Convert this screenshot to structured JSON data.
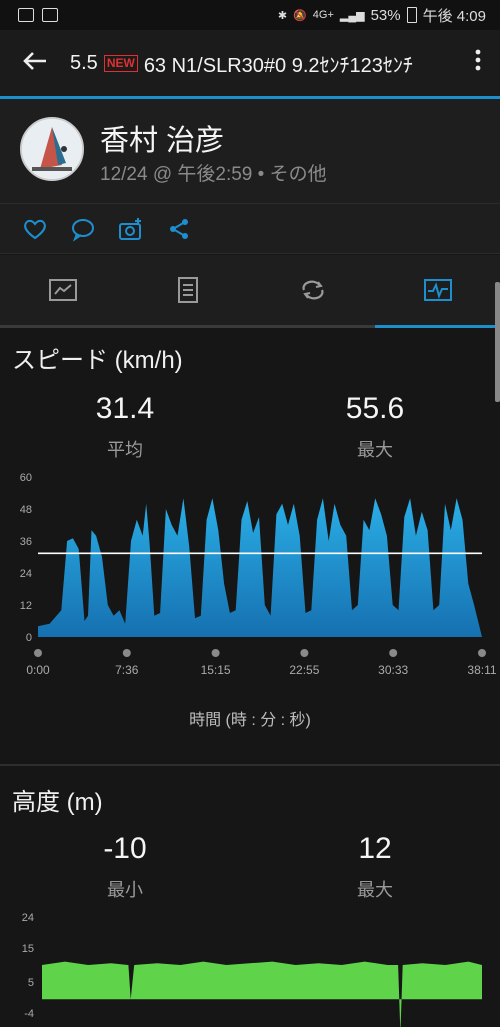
{
  "status_bar": {
    "battery": "53%",
    "time": "午後 4:09",
    "network": "4G+"
  },
  "app_bar": {
    "title_prefix": "5.5",
    "new_badge": "NEW",
    "title_suffix": "63 N1/SLR30#0  9.2ｾﾝﾁ123ｾﾝﾁ"
  },
  "profile": {
    "name": "香村 治彦",
    "meta": "12/24 @ 午後2:59 • その他"
  },
  "speed": {
    "title": "スピード (km/h)",
    "avg_value": "31.4",
    "avg_label": "平均",
    "max_value": "55.6",
    "max_label": "最大",
    "axis_title": "時間 (時 : 分 : 秒)"
  },
  "altitude": {
    "title": "高度 (m)",
    "min_value": "-10",
    "min_label": "最小",
    "max_value": "12",
    "max_label": "最大"
  },
  "colors": {
    "accent": "#1d8fcf",
    "speed_fill": "#1e9fd6",
    "alt_fill": "#5fd34a"
  },
  "chart_data": [
    {
      "type": "area",
      "name": "speed",
      "x_ticks": [
        "0:00",
        "7:36",
        "15:15",
        "22:55",
        "30:33",
        "38:11"
      ],
      "y_ticks": [
        0,
        12,
        24,
        36,
        48,
        60
      ],
      "ylim": [
        0,
        60
      ],
      "average_line": 31.4,
      "x_minutes": [
        0,
        1,
        2,
        2.5,
        3,
        3.5,
        4,
        4.3,
        4.6,
        5,
        5.5,
        6,
        6.5,
        7,
        7.5,
        8,
        8.5,
        9,
        9.3,
        9.6,
        10,
        10.5,
        11,
        11.5,
        12,
        12.5,
        13,
        13.5,
        14,
        14.5,
        15,
        15.5,
        16,
        16.5,
        17,
        17.5,
        18,
        18.5,
        19,
        19.5,
        20,
        20.5,
        21,
        21.5,
        22,
        22.5,
        23,
        23.5,
        24,
        24.5,
        25,
        25.5,
        26,
        26.5,
        27,
        27.5,
        28,
        28.5,
        29,
        29.5,
        30,
        30.5,
        31,
        31.5,
        32,
        32.5,
        33,
        33.5,
        34,
        34.5,
        35,
        35.5,
        36,
        36.5,
        37,
        37.5,
        38.18
      ],
      "values": [
        4,
        5,
        10,
        36,
        37,
        33,
        6,
        8,
        40,
        38,
        30,
        12,
        8,
        10,
        5,
        36,
        44,
        38,
        50,
        35,
        8,
        9,
        48,
        42,
        38,
        52,
        34,
        7,
        8,
        44,
        52,
        40,
        20,
        9,
        10,
        44,
        51,
        39,
        45,
        12,
        8,
        46,
        50,
        42,
        50,
        38,
        9,
        10,
        44,
        52,
        36,
        50,
        42,
        38,
        10,
        12,
        44,
        40,
        52,
        46,
        38,
        12,
        10,
        45,
        52,
        38,
        47,
        40,
        10,
        12,
        50,
        40,
        52,
        44,
        20,
        12,
        0
      ]
    },
    {
      "type": "area",
      "name": "altitude",
      "y_ticks": [
        -4,
        5,
        15,
        24
      ],
      "ylim": [
        -4,
        24
      ],
      "x_minutes": [
        0,
        2,
        4,
        6,
        7.5,
        7.7,
        8,
        10,
        12,
        14,
        16,
        18,
        20,
        22,
        24,
        26,
        28,
        30,
        30.9,
        31.1,
        31.3,
        33,
        35,
        37,
        38.18
      ],
      "values": [
        10,
        11,
        10,
        10.5,
        10,
        0,
        10,
        10.5,
        10,
        11,
        10,
        10.5,
        11,
        10,
        10.5,
        10,
        11,
        10,
        10,
        -10,
        10,
        10.5,
        10,
        11,
        10
      ]
    }
  ]
}
